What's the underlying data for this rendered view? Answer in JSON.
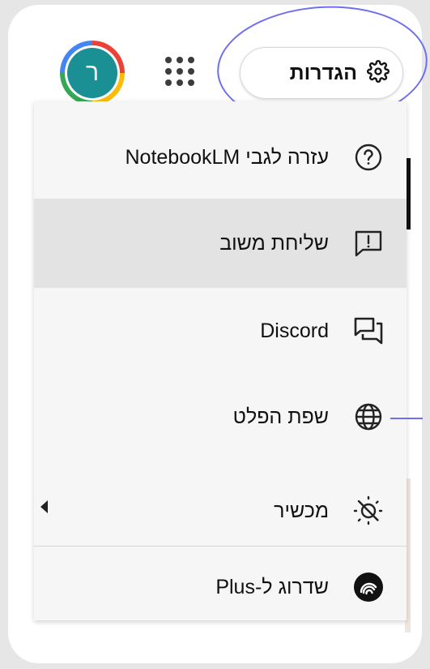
{
  "header": {
    "avatar_letter": "ר",
    "settings_label": "הגדרות",
    "apps_icon": "apps-grid-icon",
    "settings_icon": "gear-icon"
  },
  "menu": {
    "items": [
      {
        "label": "עזרה לגבי NotebookLM",
        "icon": "help-circle-icon"
      },
      {
        "label": "שליחת משוב",
        "icon": "feedback-icon"
      },
      {
        "label": "Discord",
        "icon": "forum-icon"
      },
      {
        "label": "שפת הפלט",
        "icon": "globe-icon"
      },
      {
        "label": "מכשיר",
        "icon": "theme-device-icon"
      },
      {
        "label": "שדרוג ל-Plus",
        "icon": "plus-upgrade-icon"
      }
    ]
  },
  "colors": {
    "avatar_bg": "#1a8f94",
    "annotation": "#6f6ff0",
    "hover_bg": "#e3e3e3"
  }
}
